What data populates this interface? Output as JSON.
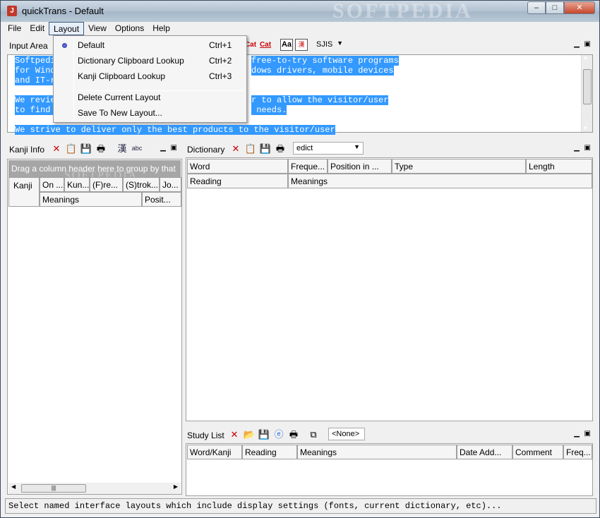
{
  "window": {
    "title": "quickTrans - Default",
    "icon_glyph": "J",
    "minimize": "–",
    "maximize": "□",
    "close": "✕"
  },
  "menu": [
    "File",
    "Edit",
    "Layout",
    "View",
    "Options",
    "Help"
  ],
  "input_area": {
    "title": "Input Area",
    "encoding": "SJIS",
    "lines": [
      {
        "left": "Softpedi",
        "right": "free-to-try software programs"
      },
      {
        "left": "for Wind",
        "right": "dows drivers, mobile devices"
      },
      {
        "left": "and IT-r",
        "right": ""
      },
      {
        "left": "",
        "right": ""
      },
      {
        "left": "We revie",
        "right": "r to allow the visitor/user"
      },
      {
        "left": "to find ",
        "right": " needs."
      },
      {
        "left": "",
        "right": ""
      },
      {
        "left": "We strive to deliver only the best products to the visitor/user",
        "right": ""
      }
    ]
  },
  "layout_menu": {
    "items": [
      {
        "label": "Default",
        "shortcut": "Ctrl+1",
        "checked": true
      },
      {
        "label": "Dictionary Clipboard Lookup",
        "shortcut": "Ctrl+2",
        "checked": false
      },
      {
        "label": "Kanji Clipboard Lookup",
        "shortcut": "Ctrl+3",
        "checked": false
      },
      {
        "label": "Delete Current Layout",
        "shortcut": "",
        "checked": false
      },
      {
        "label": "Save To New Layout...",
        "shortcut": "",
        "checked": false
      }
    ]
  },
  "kanji_info": {
    "title": "Kanji Info",
    "group_hint": "Drag a column header here to group by that",
    "watermark": "SOFTPEDIA",
    "headers_row1": [
      "Kanji",
      "On ...",
      "Kun...",
      "(F)re...",
      "(S)trok...",
      "Jo..."
    ],
    "headers_row2": [
      "Meanings",
      "Posit..."
    ]
  },
  "dictionary": {
    "title": "Dictionary",
    "dictionary_name": "edict",
    "headers_row1": [
      "Word",
      "Freque...",
      "Position in ...",
      "Type",
      "Length"
    ],
    "headers_row2": [
      "Reading",
      "Meanings"
    ]
  },
  "study_list": {
    "title": "Study List",
    "filter": "<None>",
    "headers": [
      "Word/Kanji",
      "Reading",
      "Meanings",
      "Date Add...",
      "Comment",
      "Freq..."
    ]
  },
  "status": "Select named interface layouts which include display settings (fonts, current dictionary, etc)..."
}
